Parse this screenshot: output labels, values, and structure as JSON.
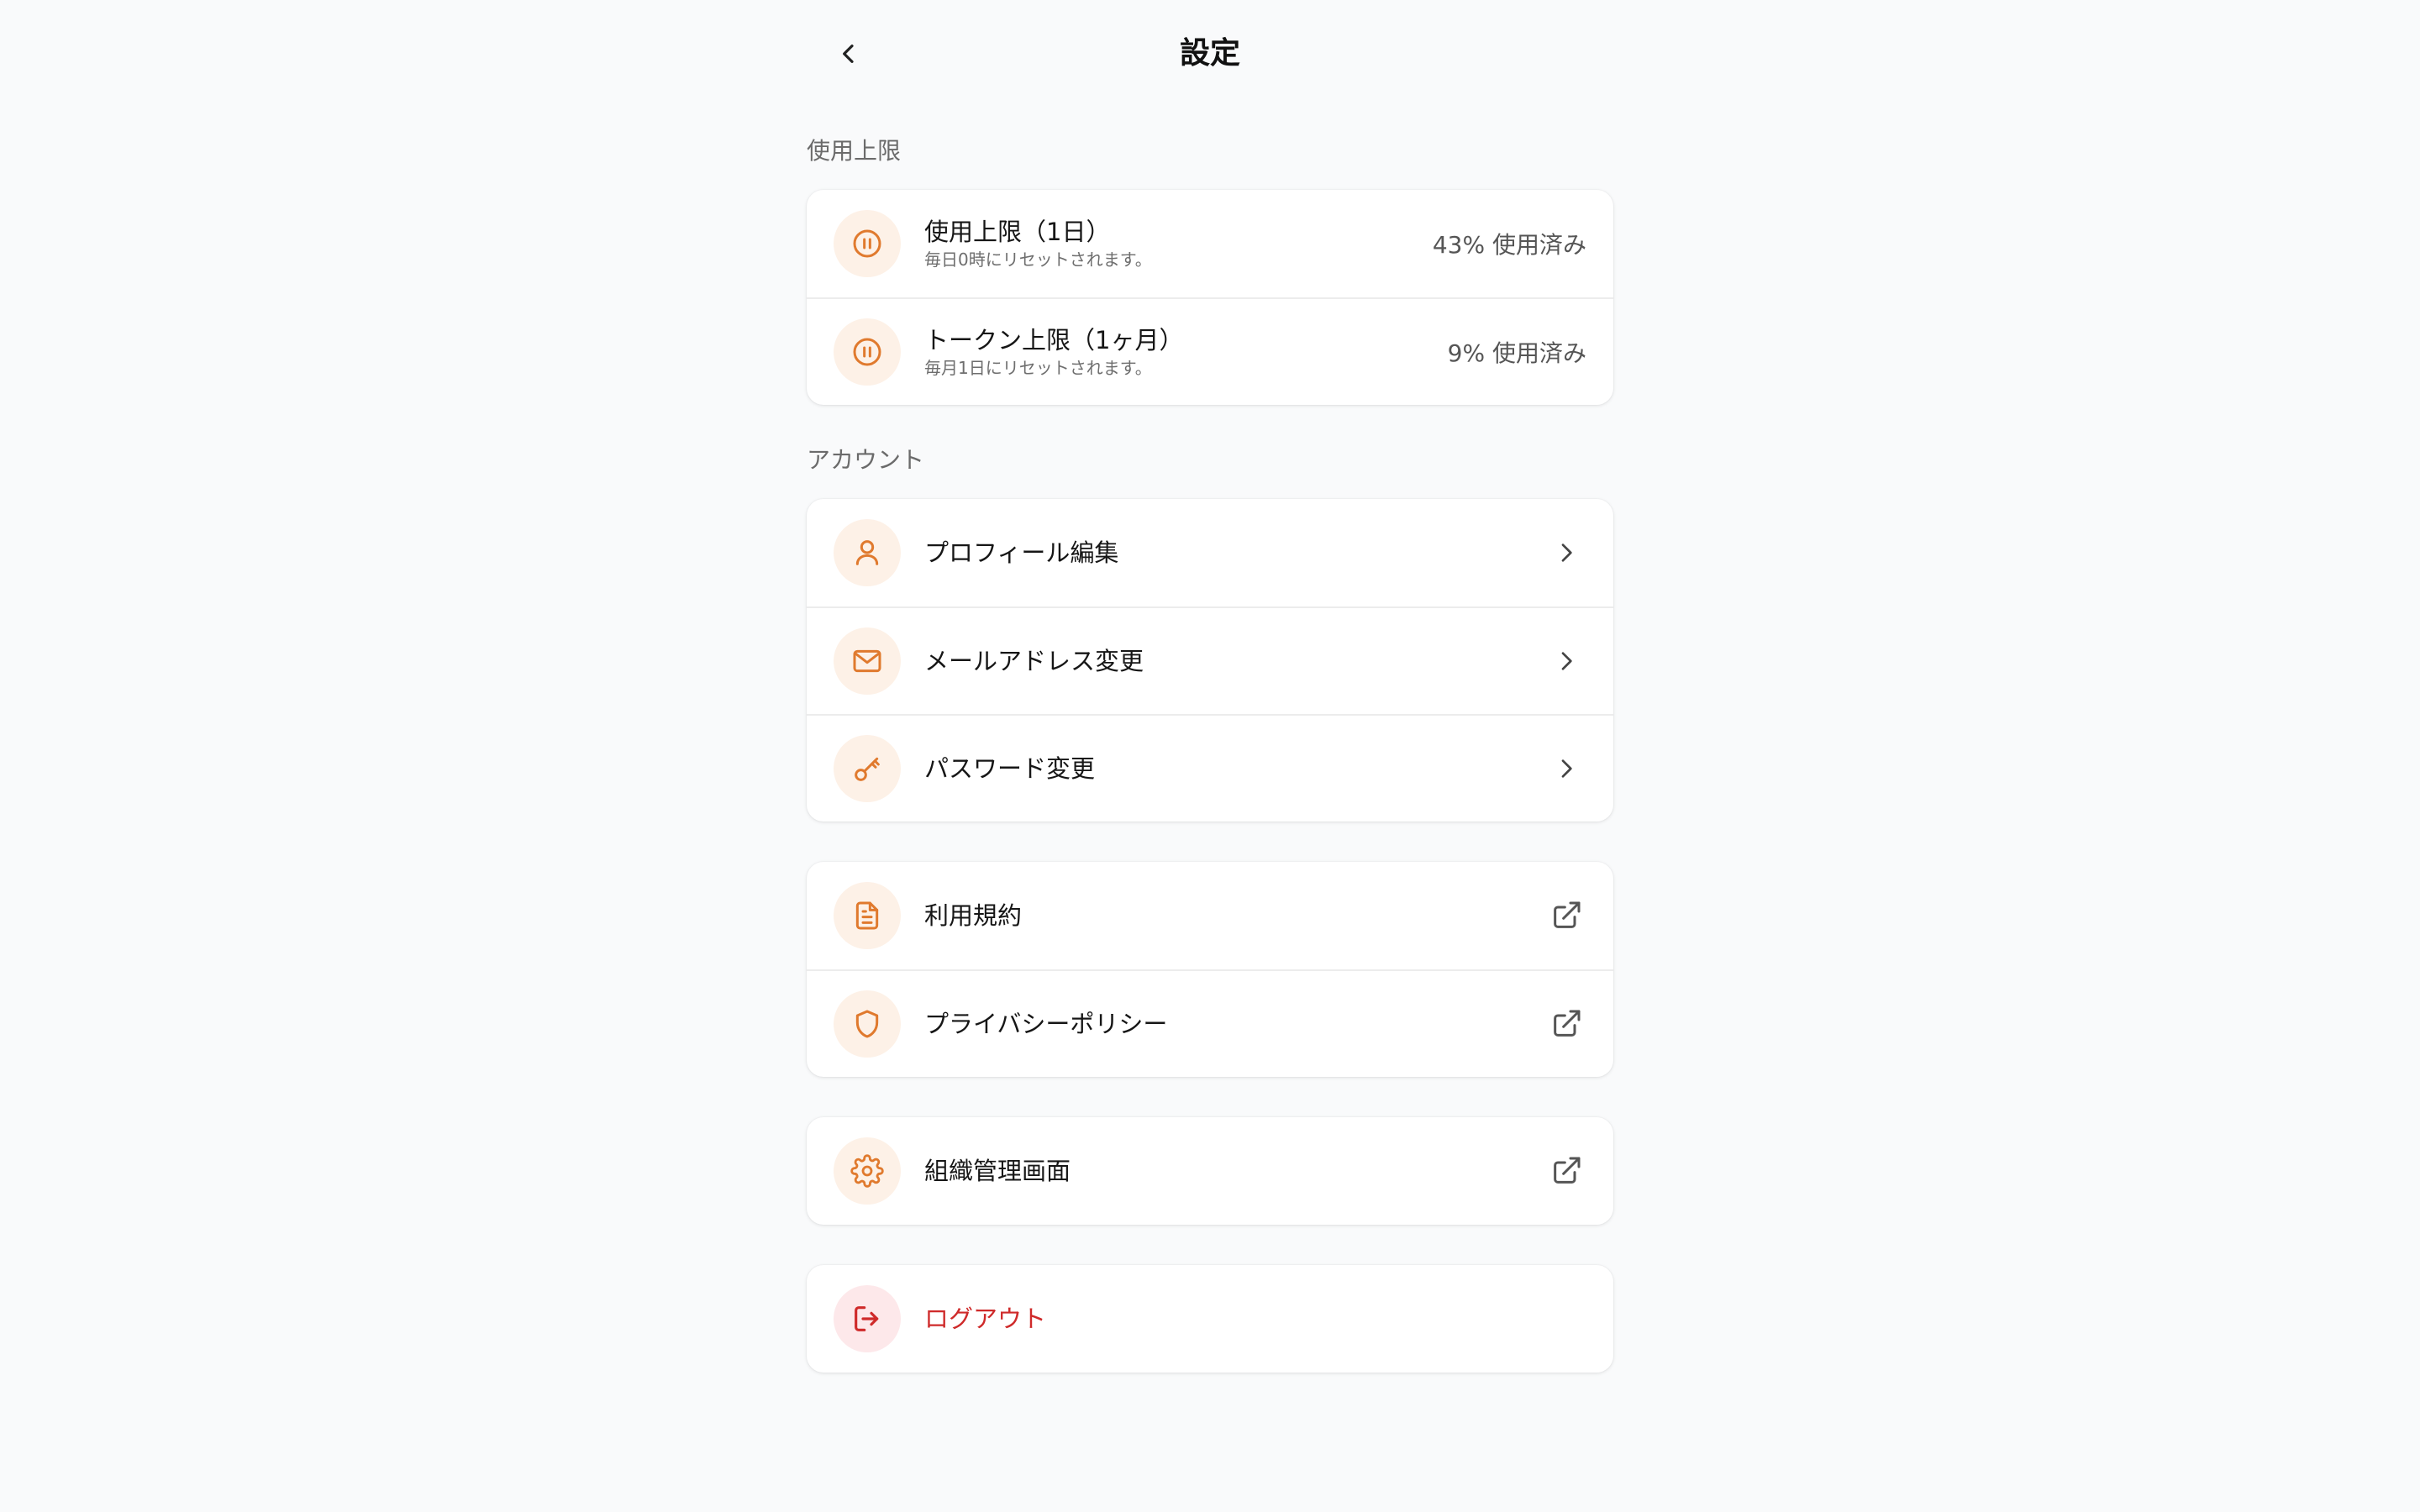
{
  "header": {
    "title": "設定",
    "back_icon": "chevron-left-icon"
  },
  "colors": {
    "accent": "#e07a2e",
    "accent_bg": "#fdf1e7",
    "danger": "#cf2a2a",
    "danger_bg": "#fde8ea",
    "background": "#f9fafb"
  },
  "usage": {
    "section_label": "使用上限",
    "items": [
      {
        "icon": "pause-circle-icon",
        "title": "使用上限（1日）",
        "subtitle": "毎日0時にリセットされます。",
        "value": "43% 使用済み"
      },
      {
        "icon": "pause-circle-icon",
        "title": "トークン上限（1ヶ月）",
        "subtitle": "毎月1日にリセットされます。",
        "value": "9% 使用済み"
      }
    ]
  },
  "account": {
    "section_label": "アカウント",
    "items": [
      {
        "icon": "user-icon",
        "label": "プロフィール編集",
        "trail": "chevron-right-icon"
      },
      {
        "icon": "mail-icon",
        "label": "メールアドレス変更",
        "trail": "chevron-right-icon"
      },
      {
        "icon": "key-icon",
        "label": "パスワード変更",
        "trail": "chevron-right-icon"
      }
    ]
  },
  "legal": {
    "items": [
      {
        "icon": "document-icon",
        "label": "利用規約",
        "trail": "external-link-icon"
      },
      {
        "icon": "shield-icon",
        "label": "プライバシーポリシー",
        "trail": "external-link-icon"
      }
    ]
  },
  "admin": {
    "items": [
      {
        "icon": "gear-icon",
        "label": "組織管理画面",
        "trail": "external-link-icon"
      }
    ]
  },
  "logout": {
    "icon": "logout-icon",
    "label": "ログアウト"
  }
}
